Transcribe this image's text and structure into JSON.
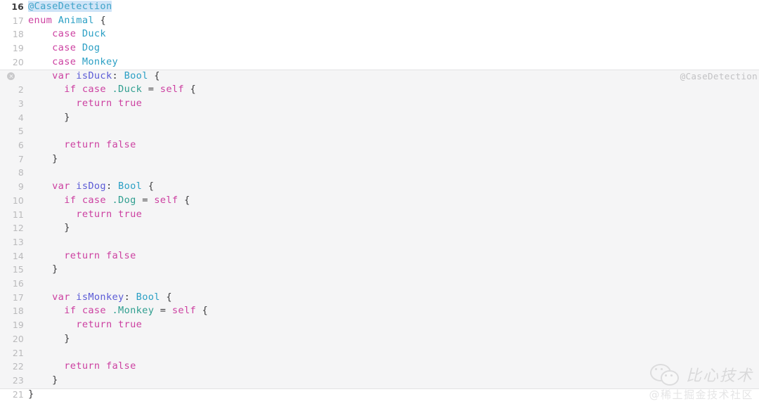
{
  "editor": {
    "language": "swift",
    "background_color": "#ffffff",
    "expansion_background_color": "#f5f5f6",
    "macro_label": "@CaseDetection",
    "gutter_marker_icon": "error-circle-icon",
    "lines": [
      {
        "num": "16",
        "current": true,
        "shaded": false,
        "marker": false,
        "indent": 0,
        "tokens": [
          {
            "t": "@CaseDetection",
            "c": "attr sel"
          }
        ]
      },
      {
        "num": "17",
        "current": false,
        "shaded": false,
        "marker": false,
        "indent": 0,
        "tokens": [
          {
            "t": "enum",
            "c": "kw"
          },
          {
            "t": " ",
            "c": "plain"
          },
          {
            "t": "Animal",
            "c": "type"
          },
          {
            "t": " {",
            "c": "plain"
          }
        ]
      },
      {
        "num": "18",
        "current": false,
        "shaded": false,
        "marker": false,
        "indent": 0,
        "tokens": [
          {
            "t": "    ",
            "c": "plain"
          },
          {
            "t": "case",
            "c": "kw"
          },
          {
            "t": " ",
            "c": "plain"
          },
          {
            "t": "Duck",
            "c": "enumc"
          }
        ]
      },
      {
        "num": "19",
        "current": false,
        "shaded": false,
        "marker": false,
        "indent": 0,
        "tokens": [
          {
            "t": "    ",
            "c": "plain"
          },
          {
            "t": "case",
            "c": "kw"
          },
          {
            "t": " ",
            "c": "plain"
          },
          {
            "t": "Dog",
            "c": "enumc"
          }
        ]
      },
      {
        "num": "20",
        "current": false,
        "shaded": false,
        "marker": false,
        "indent": 0,
        "tokens": [
          {
            "t": "    ",
            "c": "plain"
          },
          {
            "t": "case",
            "c": "kw"
          },
          {
            "t": " ",
            "c": "plain"
          },
          {
            "t": "Monkey",
            "c": "enumc"
          }
        ]
      },
      {
        "num": "",
        "current": false,
        "shaded": true,
        "marker": true,
        "macro": true,
        "indent": 0,
        "tokens": [
          {
            "t": "    ",
            "c": "plain"
          },
          {
            "t": "var",
            "c": "kw"
          },
          {
            "t": " ",
            "c": "plain"
          },
          {
            "t": "isDuck",
            "c": "ident"
          },
          {
            "t": ": ",
            "c": "plain"
          },
          {
            "t": "Bool",
            "c": "type"
          },
          {
            "t": " {",
            "c": "plain"
          }
        ]
      },
      {
        "num": "2",
        "current": false,
        "shaded": true,
        "marker": false,
        "indent": 0,
        "tokens": [
          {
            "t": "      ",
            "c": "plain"
          },
          {
            "t": "if case",
            "c": "kw"
          },
          {
            "t": " ",
            "c": "plain"
          },
          {
            "t": ".Duck",
            "c": "cased"
          },
          {
            "t": " = ",
            "c": "plain"
          },
          {
            "t": "self",
            "c": "kw"
          },
          {
            "t": " {",
            "c": "plain"
          }
        ]
      },
      {
        "num": "3",
        "current": false,
        "shaded": true,
        "marker": false,
        "indent": 0,
        "tokens": [
          {
            "t": "        ",
            "c": "plain"
          },
          {
            "t": "return true",
            "c": "kw"
          }
        ]
      },
      {
        "num": "4",
        "current": false,
        "shaded": true,
        "marker": false,
        "indent": 0,
        "tokens": [
          {
            "t": "      }",
            "c": "plain"
          }
        ]
      },
      {
        "num": "5",
        "current": false,
        "shaded": true,
        "marker": false,
        "indent": 0,
        "tokens": [
          {
            "t": "",
            "c": "plain"
          }
        ]
      },
      {
        "num": "6",
        "current": false,
        "shaded": true,
        "marker": false,
        "indent": 0,
        "tokens": [
          {
            "t": "      ",
            "c": "plain"
          },
          {
            "t": "return false",
            "c": "kw"
          }
        ]
      },
      {
        "num": "7",
        "current": false,
        "shaded": true,
        "marker": false,
        "indent": 0,
        "tokens": [
          {
            "t": "    }",
            "c": "plain"
          }
        ]
      },
      {
        "num": "8",
        "current": false,
        "shaded": true,
        "marker": false,
        "indent": 0,
        "tokens": [
          {
            "t": "",
            "c": "plain"
          }
        ]
      },
      {
        "num": "9",
        "current": false,
        "shaded": true,
        "marker": false,
        "indent": 0,
        "tokens": [
          {
            "t": "    ",
            "c": "plain"
          },
          {
            "t": "var",
            "c": "kw"
          },
          {
            "t": " ",
            "c": "plain"
          },
          {
            "t": "isDog",
            "c": "ident"
          },
          {
            "t": ": ",
            "c": "plain"
          },
          {
            "t": "Bool",
            "c": "type"
          },
          {
            "t": " {",
            "c": "plain"
          }
        ]
      },
      {
        "num": "10",
        "current": false,
        "shaded": true,
        "marker": false,
        "indent": 0,
        "tokens": [
          {
            "t": "      ",
            "c": "plain"
          },
          {
            "t": "if case",
            "c": "kw"
          },
          {
            "t": " ",
            "c": "plain"
          },
          {
            "t": ".Dog",
            "c": "cased"
          },
          {
            "t": " = ",
            "c": "plain"
          },
          {
            "t": "self",
            "c": "kw"
          },
          {
            "t": " {",
            "c": "plain"
          }
        ]
      },
      {
        "num": "11",
        "current": false,
        "shaded": true,
        "marker": false,
        "indent": 0,
        "tokens": [
          {
            "t": "        ",
            "c": "plain"
          },
          {
            "t": "return true",
            "c": "kw"
          }
        ]
      },
      {
        "num": "12",
        "current": false,
        "shaded": true,
        "marker": false,
        "indent": 0,
        "tokens": [
          {
            "t": "      }",
            "c": "plain"
          }
        ]
      },
      {
        "num": "13",
        "current": false,
        "shaded": true,
        "marker": false,
        "indent": 0,
        "tokens": [
          {
            "t": "",
            "c": "plain"
          }
        ]
      },
      {
        "num": "14",
        "current": false,
        "shaded": true,
        "marker": false,
        "indent": 0,
        "tokens": [
          {
            "t": "      ",
            "c": "plain"
          },
          {
            "t": "return false",
            "c": "kw"
          }
        ]
      },
      {
        "num": "15",
        "current": false,
        "shaded": true,
        "marker": false,
        "indent": 0,
        "tokens": [
          {
            "t": "    }",
            "c": "plain"
          }
        ]
      },
      {
        "num": "16",
        "current": false,
        "shaded": true,
        "marker": false,
        "indent": 0,
        "tokens": [
          {
            "t": "",
            "c": "plain"
          }
        ]
      },
      {
        "num": "17",
        "current": false,
        "shaded": true,
        "marker": false,
        "indent": 0,
        "tokens": [
          {
            "t": "    ",
            "c": "plain"
          },
          {
            "t": "var",
            "c": "kw"
          },
          {
            "t": " ",
            "c": "plain"
          },
          {
            "t": "isMonkey",
            "c": "ident"
          },
          {
            "t": ": ",
            "c": "plain"
          },
          {
            "t": "Bool",
            "c": "type"
          },
          {
            "t": " {",
            "c": "plain"
          }
        ]
      },
      {
        "num": "18",
        "current": false,
        "shaded": true,
        "marker": false,
        "indent": 0,
        "tokens": [
          {
            "t": "      ",
            "c": "plain"
          },
          {
            "t": "if case",
            "c": "kw"
          },
          {
            "t": " ",
            "c": "plain"
          },
          {
            "t": ".Monkey",
            "c": "cased"
          },
          {
            "t": " = ",
            "c": "plain"
          },
          {
            "t": "self",
            "c": "kw"
          },
          {
            "t": " {",
            "c": "plain"
          }
        ]
      },
      {
        "num": "19",
        "current": false,
        "shaded": true,
        "marker": false,
        "indent": 0,
        "tokens": [
          {
            "t": "        ",
            "c": "plain"
          },
          {
            "t": "return true",
            "c": "kw"
          }
        ]
      },
      {
        "num": "20",
        "current": false,
        "shaded": true,
        "marker": false,
        "indent": 0,
        "tokens": [
          {
            "t": "      }",
            "c": "plain"
          }
        ]
      },
      {
        "num": "21",
        "current": false,
        "shaded": true,
        "marker": false,
        "indent": 0,
        "tokens": [
          {
            "t": "",
            "c": "plain"
          }
        ]
      },
      {
        "num": "22",
        "current": false,
        "shaded": true,
        "marker": false,
        "indent": 0,
        "tokens": [
          {
            "t": "      ",
            "c": "plain"
          },
          {
            "t": "return false",
            "c": "kw"
          }
        ]
      },
      {
        "num": "23",
        "current": false,
        "shaded": true,
        "marker": false,
        "indent": 0,
        "tokens": [
          {
            "t": "    }",
            "c": "plain"
          }
        ]
      },
      {
        "num": "21",
        "current": false,
        "shaded": false,
        "marker": false,
        "indent": 0,
        "tokens": [
          {
            "t": "}",
            "c": "plain"
          }
        ]
      }
    ]
  },
  "watermark": {
    "icon": "wechat-icon",
    "name": "比心技术",
    "subtitle": "@稀土掘金技术社区"
  }
}
